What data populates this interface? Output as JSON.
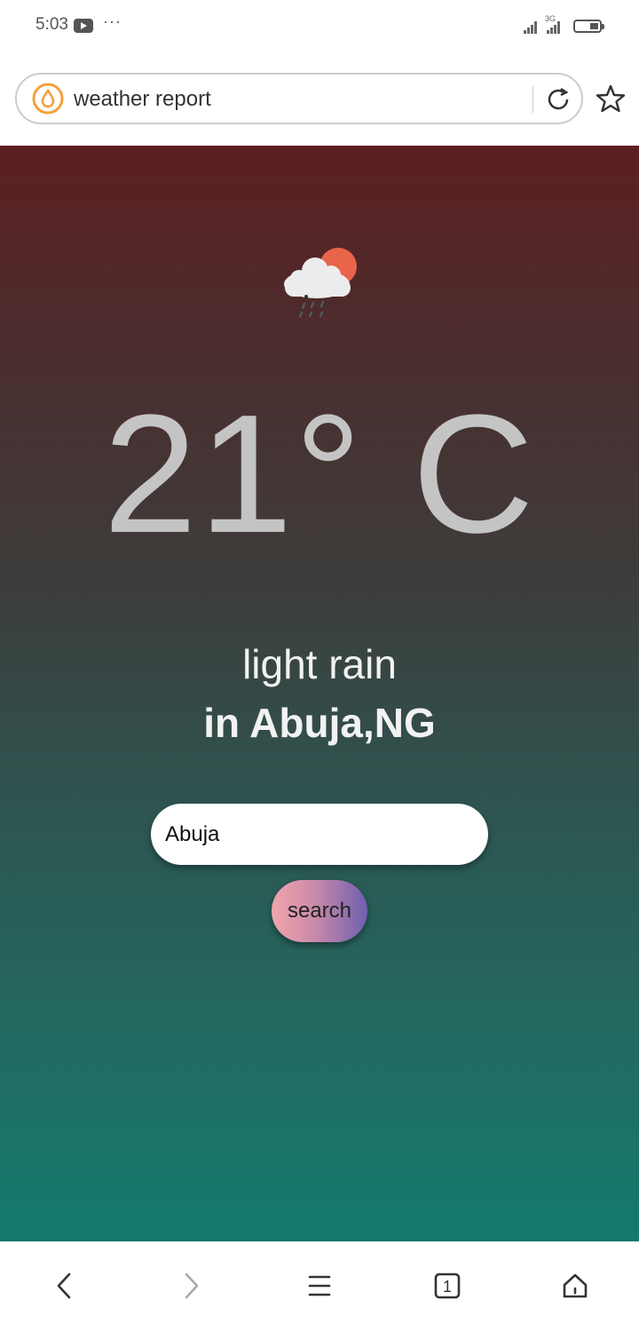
{
  "status_bar": {
    "time": "5:03",
    "more": "···",
    "network_label": "3G"
  },
  "browser": {
    "url_text": "weather report",
    "site_icon": "water-drop-icon",
    "reload_icon": "reload-icon",
    "bookmark_icon": "star-icon"
  },
  "weather": {
    "icon": "cloud-sun-rain-icon",
    "temperature": "21° C",
    "condition": "light rain",
    "location": "in Abuja,NG"
  },
  "search": {
    "input_value": "Abuja",
    "button_label": "search"
  },
  "bottom_nav": {
    "items": [
      "back-icon",
      "forward-icon",
      "menu-icon",
      "tabs-icon",
      "home-icon"
    ],
    "tab_count": "1"
  },
  "colors": {
    "gradient_top": "#5c1f21",
    "gradient_bottom": "#137a6e",
    "temperature_text": "#c4c4c4",
    "site_icon_orange": "#f5a03b"
  }
}
